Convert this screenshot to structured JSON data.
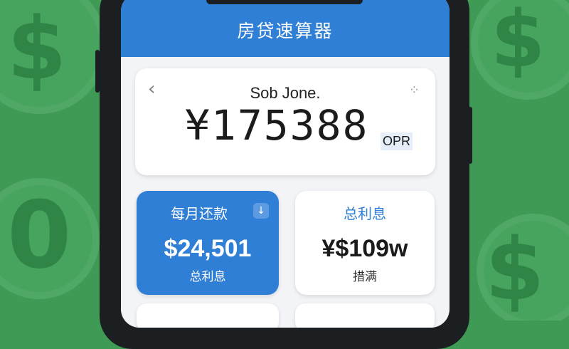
{
  "header": {
    "title": "房贷速算器"
  },
  "summary": {
    "back_icon": "chevron-left-icon",
    "back_glyph": "‹",
    "menu_icon": "more-icon",
    "menu_glyph": "⁘",
    "name": "Sob Jone.",
    "amount": "¥175388",
    "amount_unit": "OPR"
  },
  "tiles": [
    {
      "label": "每月还款",
      "value": "$24,501",
      "sub": "总利息",
      "action_icon": "download-arrow-icon",
      "action_glyph": "↓"
    },
    {
      "label": "总利息",
      "value": "¥$109w",
      "sub": "措满"
    }
  ],
  "background": {
    "symbol": "$",
    "zero": "0"
  },
  "colors": {
    "accent": "#2f7fd6",
    "background_green": "#3f9a55"
  }
}
